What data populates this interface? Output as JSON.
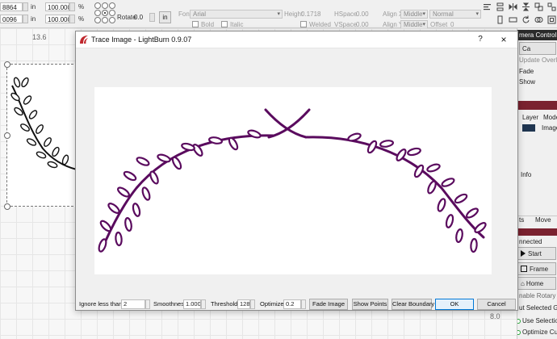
{
  "toolbar": {
    "x_value": "8864",
    "y_value": "0096",
    "unit_a": "in",
    "unit_b": "in",
    "width_pct": "100.000",
    "height_pct": "100.000",
    "pct_a": "%",
    "pct_b": "%",
    "rotate_label": "Rotate",
    "rotate_value": "0.0",
    "rotate_unit_button": "in",
    "font_label": "Font",
    "font_value": "Arial",
    "height_label": "Height",
    "height_value": "0.1718",
    "hspace_label": "HSpace",
    "hspace_value": "0.00",
    "vspace_label": "VSpace",
    "vspace_value": "0.00",
    "bold_label": "Bold",
    "italic_label": "Italic",
    "welded_label": "Welded",
    "align_x_label": "Align X",
    "align_x_value": "Middle",
    "align_y_label": "Align Y",
    "align_y_value": "Middle",
    "normal_value": "Normal",
    "offset_label": "Offset",
    "offset_value": "0"
  },
  "workspace": {
    "ruler_top": "13.6",
    "ruler_bottom": "8.0"
  },
  "right_panel": {
    "camera_header": "mera Control",
    "camera_btn": "Ca",
    "update_overlay": "Update Overlay",
    "fade": "Fade",
    "show": "Show",
    "layer_col": "Layer",
    "mode_col": "Mode",
    "image_label": "Image",
    "info_label": "Info",
    "tab_a": "ts",
    "tab_move": "Move",
    "connected": "nnected",
    "start_btn": "Start",
    "frame_btn": "Frame",
    "home_btn": "Home",
    "enable_rotary": "nable Rotary",
    "cut_selected": "ut Selected Gra",
    "use_selection": "Use Selection Or",
    "optimize_cut": "Optimize Cut Pat",
    "colors": {
      "layer_swatch": "#1f3550",
      "toggle_on": "#2aa43b"
    }
  },
  "dialog": {
    "title": "Trace Image - LightBurn 0.9.07",
    "help": "?",
    "close": "×",
    "trace_color": "#5a0b5e",
    "controls": {
      "ignore_label": "Ignore less than",
      "ignore_value": "2",
      "smoothness_label": "Smoothness",
      "smoothness_value": "1.000",
      "threshold_label": "Threshold",
      "threshold_value": "128",
      "optimize_label": "Optimize",
      "optimize_value": "0.2",
      "fade_image": "Fade Image",
      "show_points": "Show Points",
      "clear_boundary": "Clear Boundary",
      "ok": "OK",
      "cancel": "Cancel"
    }
  }
}
